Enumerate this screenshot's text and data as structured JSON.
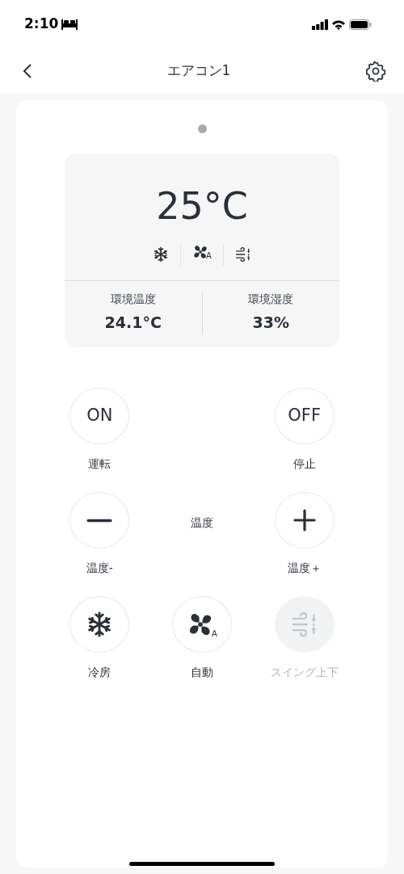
{
  "status_bar": {
    "time": "2:10"
  },
  "header": {
    "title": "エアコン1"
  },
  "panel": {
    "set_temperature": "25°C",
    "modes": [
      {
        "kind": "snowflake"
      },
      {
        "kind": "fan",
        "badge": "A"
      },
      {
        "kind": "swing"
      }
    ],
    "readings": [
      {
        "label": "環境温度",
        "value": "24.1°C"
      },
      {
        "label": "環境湿度",
        "value": "33%"
      }
    ]
  },
  "controls": [
    {
      "kind": "text",
      "text": "ON",
      "label": "運転",
      "disabled": false
    },
    {
      "kind": "empty"
    },
    {
      "kind": "text",
      "text": "OFF",
      "label": "停止",
      "disabled": false
    },
    {
      "kind": "minus",
      "label": "温度-",
      "disabled": false
    },
    {
      "kind": "caption",
      "text": "温度"
    },
    {
      "kind": "plus",
      "label": "温度＋",
      "disabled": false
    },
    {
      "kind": "snowflake",
      "label": "冷房",
      "disabled": false
    },
    {
      "kind": "fan",
      "badge": "A",
      "label": "自動",
      "disabled": false
    },
    {
      "kind": "swing",
      "label": "スイング上下",
      "disabled": true
    }
  ]
}
